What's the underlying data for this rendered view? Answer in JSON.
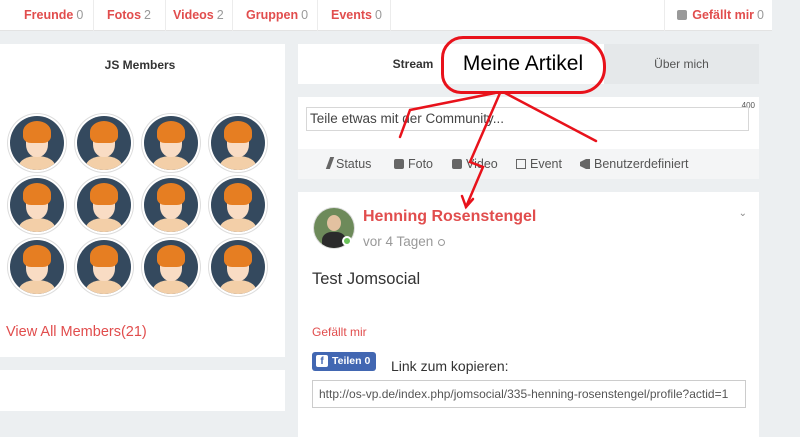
{
  "topnav": {
    "items": [
      {
        "label": "Freunde",
        "count": "0"
      },
      {
        "label": "Fotos",
        "count": "2"
      },
      {
        "label": "Videos",
        "count": "2"
      },
      {
        "label": "Gruppen",
        "count": "0"
      },
      {
        "label": "Events",
        "count": "0"
      }
    ],
    "like": {
      "label": "Gefällt mir",
      "count": "0",
      "icon": "thumbs-up-icon"
    }
  },
  "members": {
    "title": "JS Members",
    "view_all": "View All Members(21)"
  },
  "stream_tabs": {
    "stream": "Stream",
    "articles": "Meine Artikel",
    "about": "Über mich"
  },
  "composer": {
    "char_count": "400",
    "placeholder": "Teile etwas mit der Community...",
    "buttons": [
      {
        "label": "Status",
        "icon": "pencil-icon"
      },
      {
        "label": "Foto",
        "icon": "camera-icon"
      },
      {
        "label": "Video",
        "icon": "video-icon"
      },
      {
        "label": "Event",
        "icon": "calendar-icon"
      },
      {
        "label": "Benutzerdefiniert",
        "icon": "megaphone-icon"
      }
    ]
  },
  "post": {
    "author": "Henning Rosenstengel",
    "time": "vor 4 Tagen",
    "text": "Test Jomsocial",
    "like": "Gefällt mir",
    "share_label": "Teilen 0",
    "copy_label": "Link zum kopieren:",
    "copy_url": "http://os-vp.de/index.php/jomsocial/335-henning-rosenstengel/profile?actid=1"
  },
  "colors": {
    "accent": "#e14d4d",
    "annotation": "#e8121b",
    "facebook": "#4267b2"
  }
}
